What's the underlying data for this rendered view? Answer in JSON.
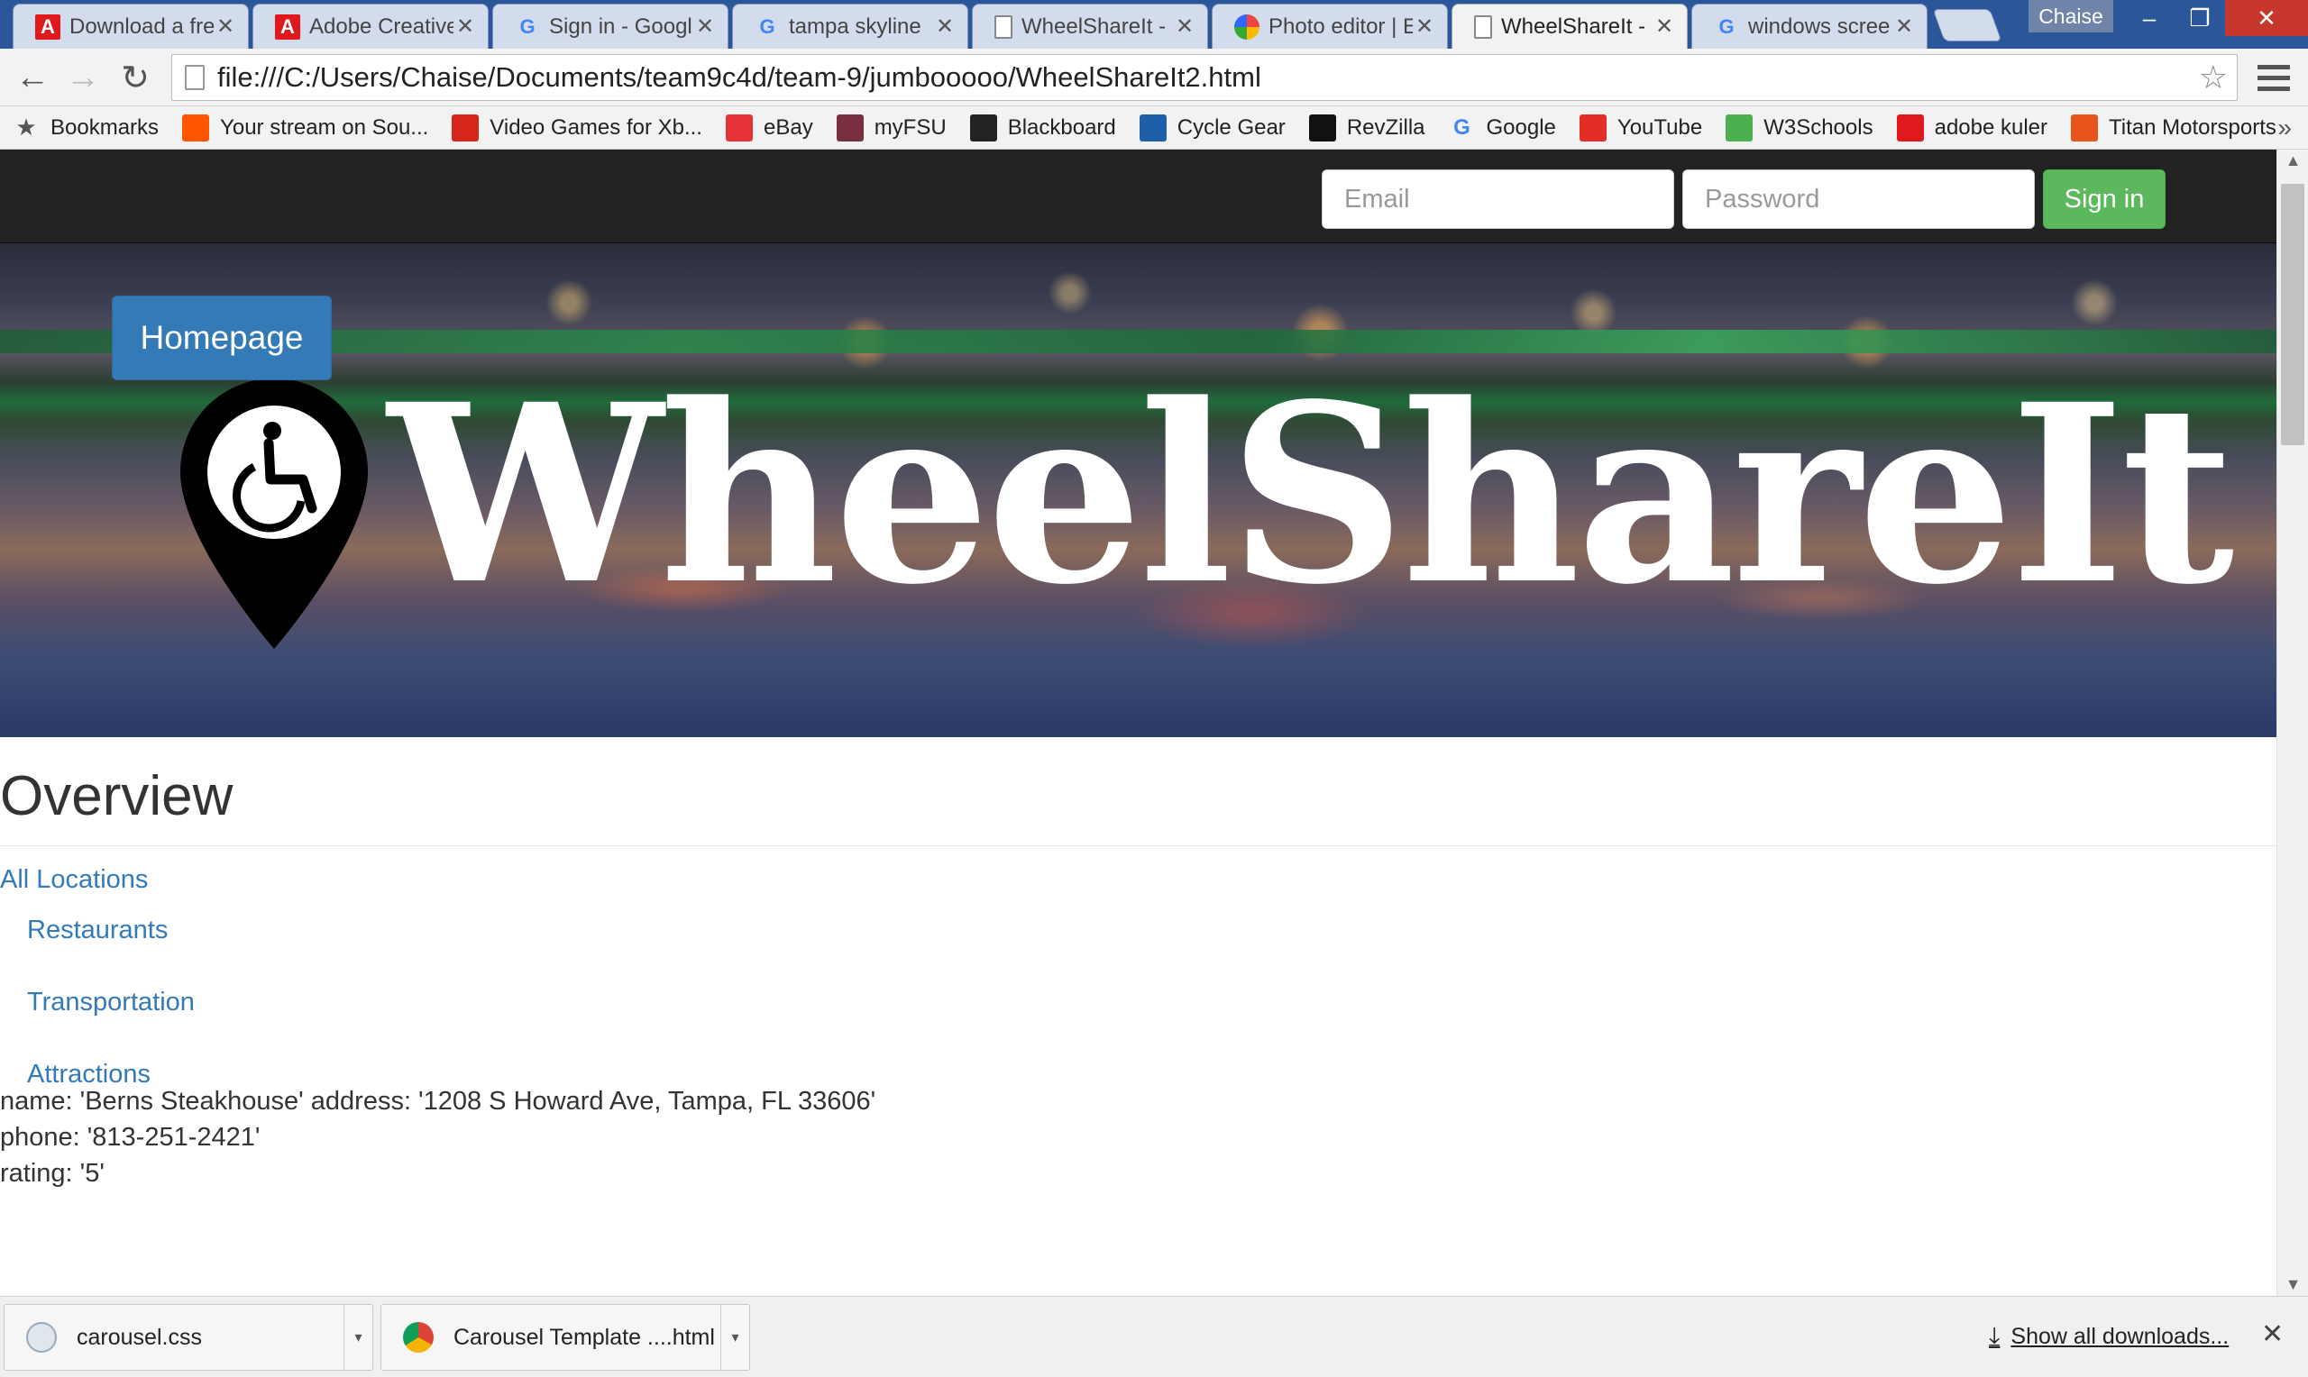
{
  "browser": {
    "tabs": [
      {
        "title": "Download a fre",
        "favicon": "adobe-icon"
      },
      {
        "title": "Adobe Creative",
        "favicon": "adobe-icon"
      },
      {
        "title": "Sign in - Googl",
        "favicon": "google-icon"
      },
      {
        "title": "tampa skyline",
        "favicon": "google-icon"
      },
      {
        "title": "WheelShareIt -",
        "favicon": "page-icon"
      },
      {
        "title": "Photo editor | E",
        "favicon": "photo-icon"
      },
      {
        "title": "WheelShareIt -",
        "favicon": "page-icon",
        "active": true
      },
      {
        "title": "windows scree",
        "favicon": "google-icon"
      }
    ],
    "profile_name": "Chaise",
    "address": "file:///C:/Users/Chaise/Documents/team9c4d/team-9/jumbooooo/WheelShareIt2.html",
    "bookmarks": [
      {
        "label": "Bookmarks",
        "icon": "star-icon",
        "color": "#555555"
      },
      {
        "label": "Your stream on Sou...",
        "icon": "soundcloud-icon",
        "color": "#ff5500"
      },
      {
        "label": "Video Games for Xb...",
        "icon": "xf-icon",
        "color": "#d6261c"
      },
      {
        "label": "eBay",
        "icon": "ebay-icon",
        "color": "#e53238"
      },
      {
        "label": "myFSU",
        "icon": "fsu-icon",
        "color": "#782f40"
      },
      {
        "label": "Blackboard",
        "icon": "blackboard-icon",
        "color": "#222222"
      },
      {
        "label": "Cycle Gear",
        "icon": "cyclegear-icon",
        "color": "#1d5fa8"
      },
      {
        "label": "RevZilla",
        "icon": "revzilla-icon",
        "color": "#111111"
      },
      {
        "label": "Google",
        "icon": "google-icon",
        "color": "#4285f4"
      },
      {
        "label": "YouTube",
        "icon": "youtube-icon",
        "color": "#e52d27"
      },
      {
        "label": "W3Schools",
        "icon": "w3schools-icon",
        "color": "#4caf50"
      },
      {
        "label": "adobe kuler",
        "icon": "adobe-icon",
        "color": "#e0191d"
      },
      {
        "label": "Titan Motorsports",
        "icon": "titan-icon",
        "color": "#e8541c"
      }
    ],
    "bookmarks_overflow": "»"
  },
  "page": {
    "email_placeholder": "Email",
    "password_placeholder": "Password",
    "signin_label": "Sign in",
    "homepage_label": "Homepage",
    "brand_name": "WheelShareIt",
    "overview_heading": "Overview",
    "all_locations_link": "All Locations",
    "sub_links": [
      "Restaurants",
      "Transportation",
      "Attractions"
    ],
    "record_lines": [
      "name: 'Berns Steakhouse' address: '1208 S Howard Ave, Tampa, FL 33606'",
      "phone: '813-251-2421'",
      "rating: '5'"
    ],
    "colors": {
      "navbar": "#222222",
      "signin_green": "#5cb85c",
      "primary_blue": "#337ab7",
      "link_blue": "#337ab7"
    }
  },
  "downloads": {
    "items": [
      {
        "name": "carousel.css",
        "icon": "css-file-icon"
      },
      {
        "name": "Carousel Template ....html",
        "icon": "chrome-icon"
      }
    ],
    "show_all_label": "Show all downloads..."
  }
}
